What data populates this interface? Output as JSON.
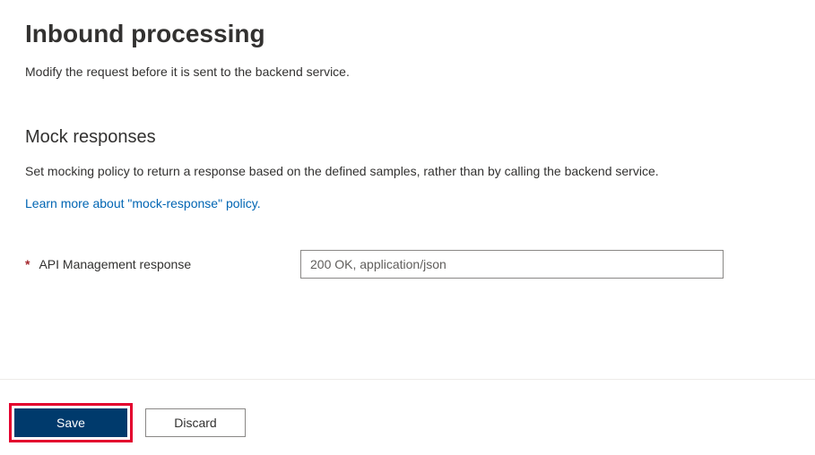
{
  "header": {
    "title": "Inbound processing",
    "subtitle": "Modify the request before it is sent to the backend service."
  },
  "mock": {
    "section_title": "Mock responses",
    "description": "Set mocking policy to return a response based on the defined samples, rather than by calling the backend service.",
    "learn_more": "Learn more about \"mock-response\" policy.",
    "field_label": "API Management response",
    "required_marker": "*",
    "response_value": "200 OK, application/json"
  },
  "actions": {
    "save": "Save",
    "discard": "Discard"
  }
}
